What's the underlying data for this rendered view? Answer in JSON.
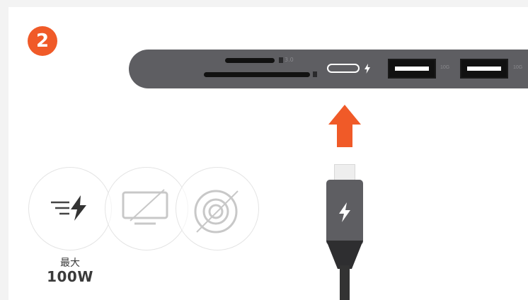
{
  "step": {
    "number": "2"
  },
  "hub": {
    "sd_label": "3.0",
    "usb_a_labels": [
      "10G",
      "10G"
    ]
  },
  "power": {
    "label_small": "最大",
    "label_big": "100W"
  },
  "icons": {
    "step_badge": "step-2-badge",
    "arrow": "arrow-up-icon",
    "charge": "fast-charge-icon",
    "display": "display-disabled-icon",
    "speaker": "audio-disabled-icon"
  },
  "colors": {
    "accent": "#f05a28",
    "hub_body": "#5e5e62",
    "port": "#111111"
  }
}
